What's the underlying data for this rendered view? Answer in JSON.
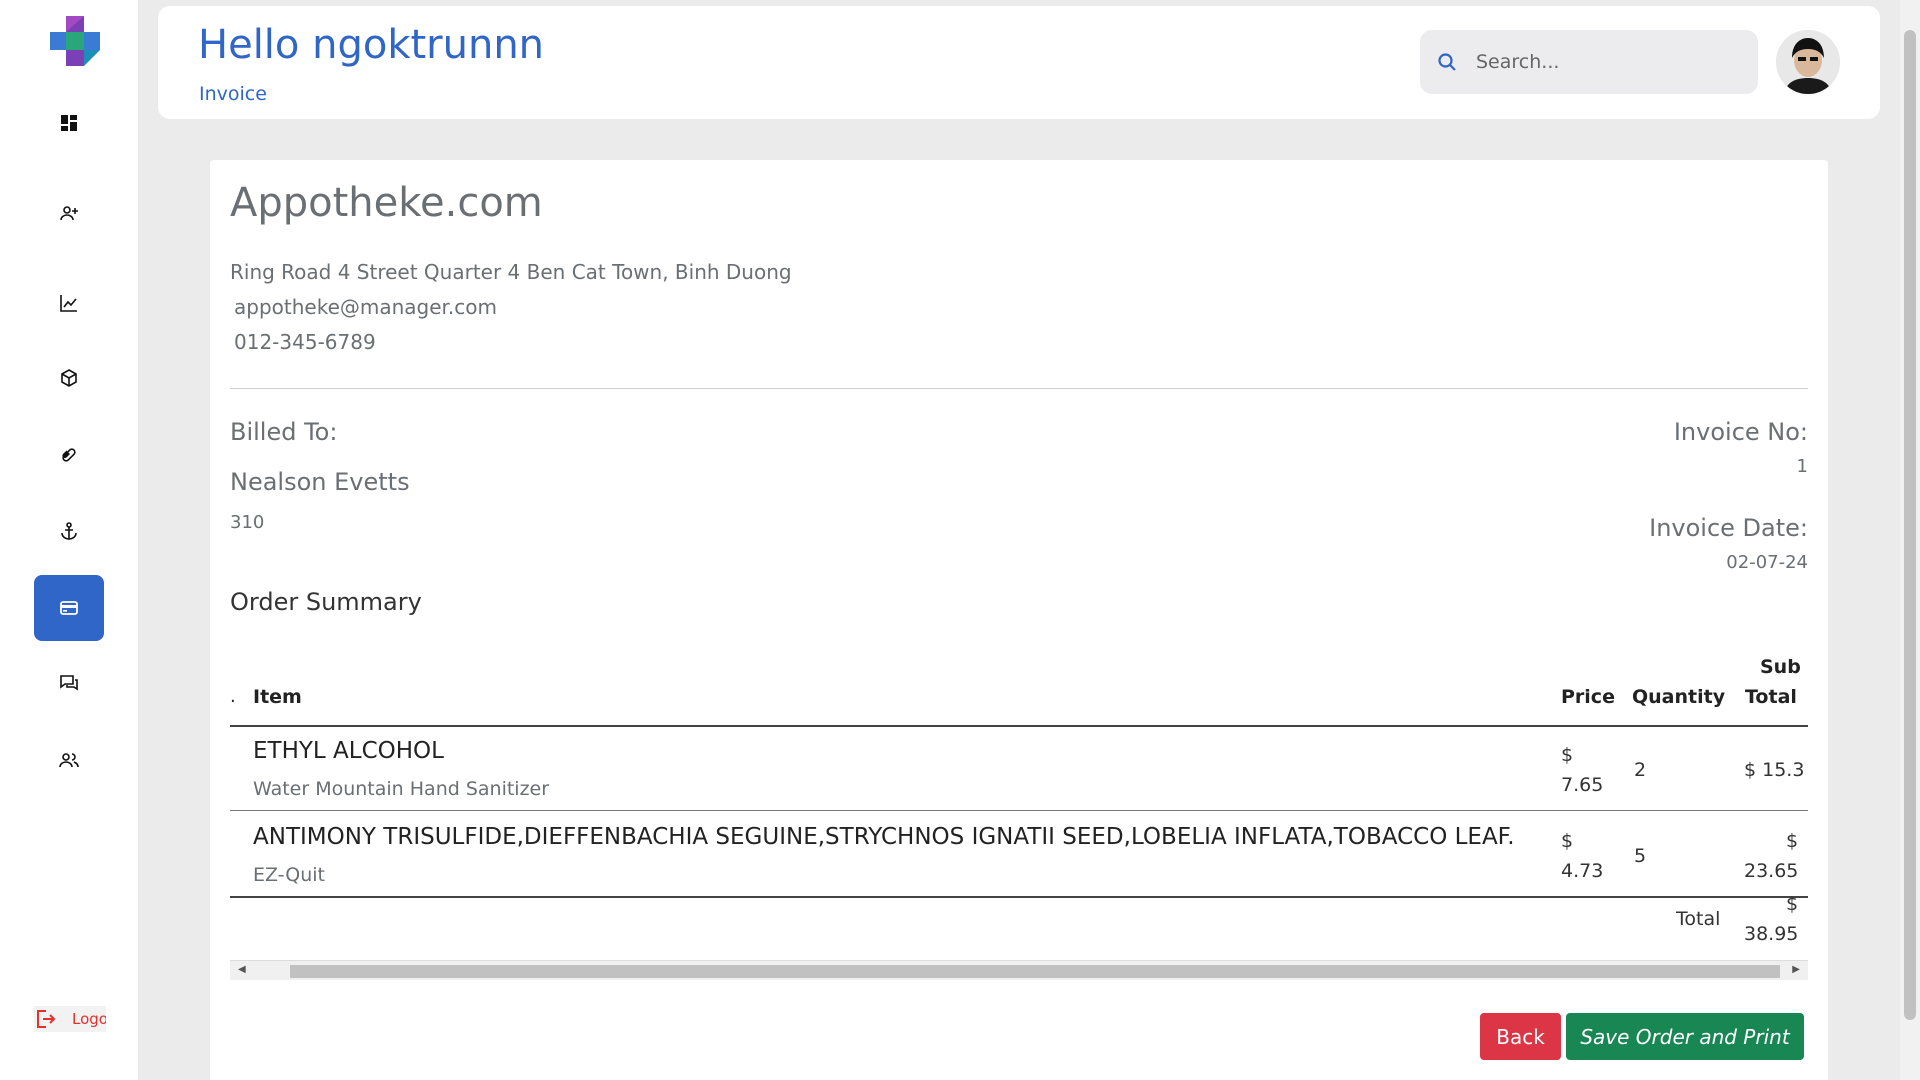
{
  "colors": {
    "accent": "#2f66c7",
    "danger": "#dc3545",
    "success": "#198754",
    "logout": "#e0322f"
  },
  "sidebar": {
    "items": [
      {
        "name": "dashboard",
        "icon": "grid-icon"
      },
      {
        "name": "add-user",
        "icon": "user-plus-icon"
      },
      {
        "name": "analytics",
        "icon": "chart-line-icon"
      },
      {
        "name": "inventory",
        "icon": "box-icon"
      },
      {
        "name": "medicine",
        "icon": "pill-icon"
      },
      {
        "name": "ports",
        "icon": "anchor-icon"
      },
      {
        "name": "invoice",
        "icon": "credit-card-icon",
        "active": true
      },
      {
        "name": "messages",
        "icon": "chat-icon"
      },
      {
        "name": "users",
        "icon": "users-icon"
      }
    ],
    "logout_label": "Logout"
  },
  "header": {
    "greeting": "Hello ngoktrunnn",
    "breadcrumb": "Invoice",
    "search_placeholder": "Search..."
  },
  "invoice": {
    "company": "Appotheke.com",
    "address": "Ring Road 4 Street Quarter 4 Ben Cat Town, Binh Duong",
    "email": "appotheke@manager.com",
    "phone": "012-345-6789",
    "billed_to_label": "Billed To:",
    "billed_name": "Nealson Evetts",
    "billed_sub": "310",
    "invoice_no_label": "Invoice No:",
    "invoice_no": "1",
    "invoice_date_label": "Invoice Date:",
    "invoice_date": "02-07-24",
    "order_summary_label": "Order Summary",
    "columns": {
      "dot": ".",
      "item": "Item",
      "price": "Price",
      "quantity": "Quantity",
      "subtotal_1": "Sub",
      "subtotal_2": "Total"
    },
    "rows": [
      {
        "name": "ETHYL ALCOHOL",
        "sub": "Water Mountain Hand Sanitizer",
        "price_sym": "$",
        "price": "7.65",
        "qty": "2",
        "subtotal": "$ 15.3"
      },
      {
        "name": "ANTIMONY TRISULFIDE,DIEFFENBACHIA SEGUINE,STRYCHNOS IGNATII SEED,LOBELIA INFLATA,TOBACCO LEAF.",
        "sub": "EZ-Quit",
        "price_sym": "$",
        "price": "4.73",
        "qty": "5",
        "subtotal_sym": "$",
        "subtotal": "23.65"
      }
    ],
    "total_label": "Total",
    "total_sym": "$",
    "total": "38.95"
  },
  "buttons": {
    "back": "Back",
    "save": "Save Order and Print"
  }
}
